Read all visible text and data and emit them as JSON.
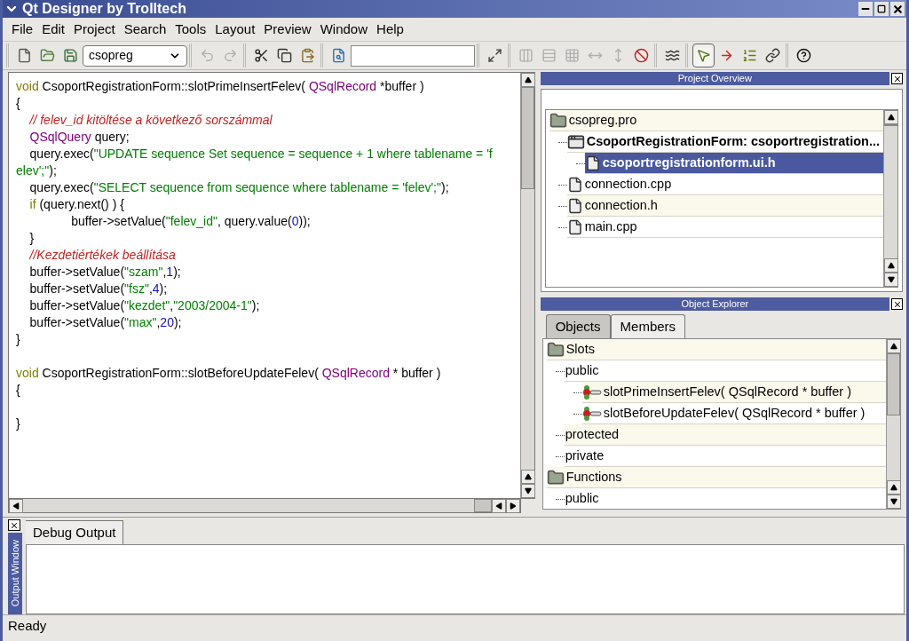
{
  "window": {
    "title": "Qt Designer by Trolltech"
  },
  "menu": [
    "File",
    "Edit",
    "Project",
    "Search",
    "Tools",
    "Layout",
    "Preview",
    "Window",
    "Help"
  ],
  "toolbar": {
    "groups": [
      [
        {
          "kind": "new",
          "disabled": false
        },
        {
          "kind": "open",
          "disabled": false
        },
        {
          "kind": "save",
          "disabled": false
        },
        {
          "kind": "combo",
          "value": "csopreg"
        }
      ],
      [
        {
          "kind": "undo",
          "disabled": true
        },
        {
          "kind": "redo",
          "disabled": true
        }
      ],
      [
        {
          "kind": "cut",
          "disabled": false
        },
        {
          "kind": "copy",
          "disabled": false
        },
        {
          "kind": "paste",
          "disabled": false
        }
      ],
      [
        {
          "kind": "find",
          "disabled": false
        },
        {
          "kind": "field"
        }
      ],
      [
        {
          "kind": "adjust-size",
          "disabled": false
        }
      ],
      [
        {
          "kind": "layout-h",
          "disabled": true
        },
        {
          "kind": "layout-v",
          "disabled": true
        },
        {
          "kind": "layout-grid",
          "disabled": true
        },
        {
          "kind": "split-h",
          "disabled": true
        },
        {
          "kind": "split-v",
          "disabled": true
        },
        {
          "kind": "break-layout",
          "disabled": false
        }
      ],
      [
        {
          "kind": "spacer",
          "disabled": false
        }
      ],
      [
        {
          "kind": "pointer",
          "disabled": false,
          "selected": true
        },
        {
          "kind": "connect",
          "disabled": false,
          "selected": false
        },
        {
          "kind": "tab-order",
          "disabled": false,
          "selected": false
        },
        {
          "kind": "buddy",
          "disabled": false,
          "selected": false
        }
      ],
      [
        {
          "kind": "whats-this",
          "disabled": false
        }
      ]
    ]
  },
  "editor": {
    "lines": [
      {
        "kind": "code",
        "tokens": [
          {
            "kind": "keyword",
            "text": "void"
          },
          {
            "kind": "plain",
            "text": " CsoportRegistrationForm::slotPrimeInsertFelev( "
          },
          {
            "kind": "type",
            "text": "QSqlRecord"
          },
          {
            "kind": "plain",
            "text": " *buffer )"
          }
        ]
      },
      {
        "kind": "code",
        "tokens": [
          {
            "kind": "plain",
            "text": "{"
          }
        ]
      },
      {
        "kind": "code",
        "tokens": [
          {
            "kind": "comment",
            "text": "    // felev_id kitöltése a következő sorszámmal"
          }
        ]
      },
      {
        "kind": "code",
        "tokens": [
          {
            "kind": "type",
            "text": "    QSqlQuery"
          },
          {
            "kind": "plain",
            "text": " query;"
          }
        ]
      },
      {
        "kind": "code",
        "tokens": [
          {
            "kind": "plain",
            "text": "    query.exec("
          },
          {
            "kind": "string",
            "text": "\"UPDATE sequence Set sequence = sequence + 1 where tablename = 'f"
          }
        ]
      },
      {
        "kind": "code",
        "tokens": [
          {
            "kind": "string",
            "text": "elev';\""
          },
          {
            "kind": "plain",
            "text": ");"
          }
        ]
      },
      {
        "kind": "code",
        "tokens": [
          {
            "kind": "plain",
            "text": "    query.exec("
          },
          {
            "kind": "string",
            "text": "\"SELECT sequence from sequence where tablename = 'felev';\""
          },
          {
            "kind": "plain",
            "text": ");"
          }
        ]
      },
      {
        "kind": "code",
        "tokens": [
          {
            "kind": "keyword",
            "text": "    if"
          },
          {
            "kind": "plain",
            "text": " (query.next() ) {"
          }
        ]
      },
      {
        "kind": "code",
        "tokens": [
          {
            "kind": "plain",
            "text": "                buffer->setValue("
          },
          {
            "kind": "string",
            "text": "\"felev_id\""
          },
          {
            "kind": "plain",
            "text": ", query.value("
          },
          {
            "kind": "number",
            "text": "0"
          },
          {
            "kind": "plain",
            "text": "));"
          }
        ]
      },
      {
        "kind": "code",
        "tokens": [
          {
            "kind": "plain",
            "text": "    }"
          }
        ]
      },
      {
        "kind": "code",
        "tokens": [
          {
            "kind": "comment",
            "text": "    //Kezdetiértékek beállítása"
          }
        ]
      },
      {
        "kind": "code",
        "tokens": [
          {
            "kind": "plain",
            "text": "    buffer->setValue("
          },
          {
            "kind": "string",
            "text": "\"szam\""
          },
          {
            "kind": "plain",
            "text": ","
          },
          {
            "kind": "number",
            "text": "1"
          },
          {
            "kind": "plain",
            "text": ");"
          }
        ]
      },
      {
        "kind": "code",
        "tokens": [
          {
            "kind": "plain",
            "text": "    buffer->setValue("
          },
          {
            "kind": "string",
            "text": "\"fsz\""
          },
          {
            "kind": "plain",
            "text": ","
          },
          {
            "kind": "number",
            "text": "4"
          },
          {
            "kind": "plain",
            "text": ");"
          }
        ]
      },
      {
        "kind": "code",
        "tokens": [
          {
            "kind": "plain",
            "text": "    buffer->setValue("
          },
          {
            "kind": "string",
            "text": "\"kezdet\""
          },
          {
            "kind": "plain",
            "text": ","
          },
          {
            "kind": "string",
            "text": "\"2003/2004-1\""
          },
          {
            "kind": "plain",
            "text": ");"
          }
        ]
      },
      {
        "kind": "code",
        "tokens": [
          {
            "kind": "plain",
            "text": "    buffer->setValue("
          },
          {
            "kind": "string",
            "text": "\"max\""
          },
          {
            "kind": "plain",
            "text": ","
          },
          {
            "kind": "number",
            "text": "20"
          },
          {
            "kind": "plain",
            "text": ");"
          }
        ]
      },
      {
        "kind": "code",
        "tokens": [
          {
            "kind": "plain",
            "text": "}"
          }
        ]
      },
      {
        "kind": "blank"
      },
      {
        "kind": "code",
        "tokens": [
          {
            "kind": "keyword",
            "text": "void"
          },
          {
            "kind": "plain",
            "text": " CsoportRegistrationForm::slotBeforeUpdateFelev( "
          },
          {
            "kind": "type",
            "text": "QSqlRecord"
          },
          {
            "kind": "plain",
            "text": " * buffer )"
          }
        ]
      },
      {
        "kind": "code",
        "tokens": [
          {
            "kind": "plain",
            "text": "{"
          }
        ]
      },
      {
        "kind": "blank"
      },
      {
        "kind": "code",
        "tokens": [
          {
            "kind": "plain",
            "text": "}"
          }
        ]
      }
    ]
  },
  "project_overview": {
    "title": "Project Overview",
    "items": [
      {
        "kind": "project",
        "label": "csopreg.pro",
        "selected": false,
        "expanded": true,
        "children": [
          {
            "kind": "form",
            "label": "CsoportRegistrationForm: csoportregistration...",
            "selected": false,
            "expanded": true,
            "children": [
              {
                "kind": "file",
                "label": "csoportregistrationform.ui.h",
                "selected": true
              }
            ]
          },
          {
            "kind": "file",
            "label": "connection.cpp",
            "selected": false
          },
          {
            "kind": "file",
            "label": "connection.h",
            "selected": false
          },
          {
            "kind": "file",
            "label": "main.cpp",
            "selected": false
          }
        ]
      }
    ]
  },
  "object_explorer": {
    "title": "Object Explorer",
    "tabs": [
      {
        "label": "Objects",
        "selected": false
      },
      {
        "label": "Members",
        "selected": true
      }
    ],
    "items": [
      {
        "kind": "folder",
        "label": "Slots",
        "expanded": true,
        "children": [
          {
            "kind": "group",
            "label": "public",
            "expanded": true,
            "children": [
              {
                "kind": "slot",
                "label": "slotPrimeInsertFelev( QSqlRecord * buffer )"
              },
              {
                "kind": "slot",
                "label": "slotBeforeUpdateFelev( QSqlRecord * buffer )"
              }
            ]
          },
          {
            "kind": "group",
            "label": "protected",
            "expanded": false
          },
          {
            "kind": "group",
            "label": "private",
            "expanded": false
          }
        ]
      },
      {
        "kind": "folder",
        "label": "Functions",
        "expanded": true,
        "children": [
          {
            "kind": "group",
            "label": "public",
            "expanded": false
          }
        ]
      }
    ]
  },
  "output_window": {
    "title": "Output Window",
    "tabs": [
      {
        "label": "Debug Output",
        "selected": true
      }
    ]
  },
  "status_bar": "Ready"
}
